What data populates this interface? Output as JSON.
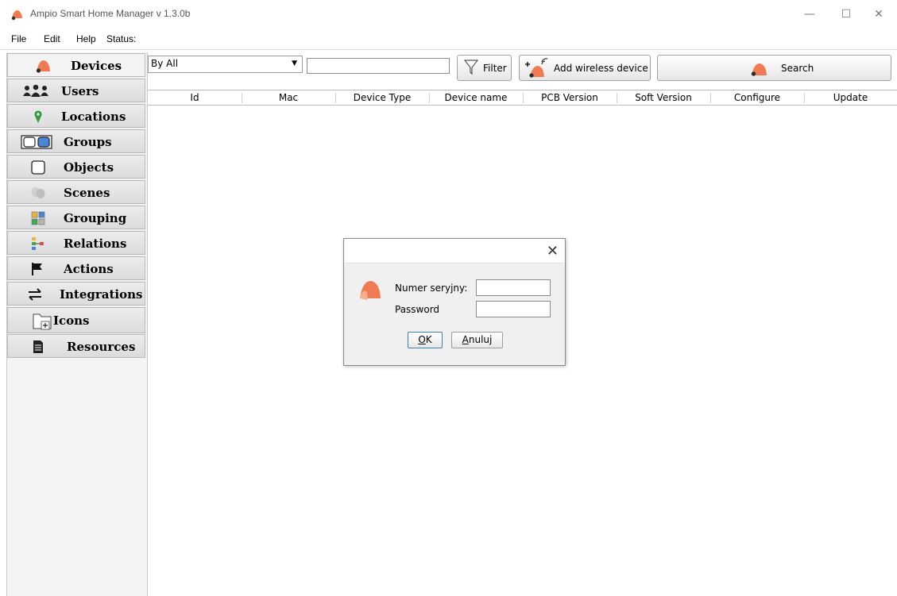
{
  "window": {
    "title": "Ampio Smart Home Manager v 1.3.0b",
    "controls": {
      "minimize": "—",
      "maximize": "☐",
      "close": "✕"
    }
  },
  "menu": [
    "File",
    "Edit",
    "Help",
    "Status:"
  ],
  "sidebar": {
    "items": [
      {
        "label": "Devices",
        "icon": "ampio-logo-icon"
      },
      {
        "label": "Users",
        "icon": "users-icon"
      },
      {
        "label": "Locations",
        "icon": "location-pin-icon"
      },
      {
        "label": "Groups",
        "icon": "groups-icon"
      },
      {
        "label": "Objects",
        "icon": "object-square-icon"
      },
      {
        "label": "Scenes",
        "icon": "theater-masks-icon"
      },
      {
        "label": "Grouping",
        "icon": "grid-colors-icon"
      },
      {
        "label": "Relations",
        "icon": "relations-icon"
      },
      {
        "label": "Actions",
        "icon": "flag-icon"
      },
      {
        "label": "Integrations",
        "icon": "swap-arrows-icon"
      },
      {
        "label": "Icons",
        "icon": "folder-add-icon"
      },
      {
        "label": "Resources",
        "icon": "document-icon"
      }
    ]
  },
  "toolbar": {
    "filter_select_value": "By All",
    "search_value": "",
    "filter_label": "Filter",
    "add_wireless_label": "Add wireless device",
    "search_label": "Search"
  },
  "table": {
    "columns": [
      "Id",
      "Mac",
      "Device Type",
      "Device name",
      "PCB Version",
      "Soft Version",
      "Configure",
      "Update"
    ],
    "rows": []
  },
  "dialog": {
    "close": "✕",
    "serial_label": "Numer seryjny:",
    "password_label": "Password",
    "serial_value": "",
    "password_value": "",
    "ok_label": "OK",
    "ok_mnemonic": "O",
    "ok_rest": "K",
    "cancel_mnemonic": "A",
    "cancel_rest": "nuluj",
    "cancel_label": "Anuluj"
  },
  "colors": {
    "brand_orange": "#f07a52",
    "brand_dark": "#2b2b2b",
    "accent_blue": "#3c7fb1"
  }
}
